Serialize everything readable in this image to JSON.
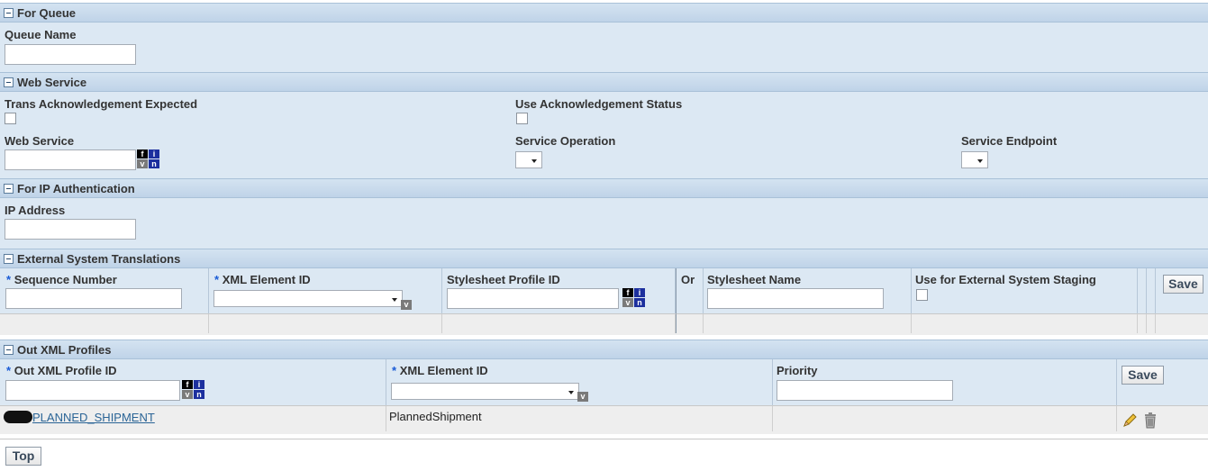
{
  "for_queue": {
    "title": "For Queue",
    "queue_name_label": "Queue Name",
    "queue_name_value": ""
  },
  "web_service": {
    "title": "Web Service",
    "trans_ack_label": "Trans Acknowledgement Expected",
    "use_ack_label": "Use Acknowledgement Status",
    "web_service_label": "Web Service",
    "web_service_value": "",
    "service_operation_label": "Service Operation",
    "service_endpoint_label": "Service Endpoint"
  },
  "ip_auth": {
    "title": "For IP Authentication",
    "ip_label": "IP Address",
    "ip_value": ""
  },
  "ext_trans": {
    "title": "External System Translations",
    "req_mark": "*",
    "seq_label": "Sequence Number",
    "xml_elem_label": "XML Element ID",
    "stylesheet_profile_label": "Stylesheet Profile ID",
    "or_label": "Or",
    "stylesheet_name_label": "Stylesheet Name",
    "use_staging_label": "Use for External System Staging",
    "save_label": "Save"
  },
  "out_xml": {
    "title": "Out XML Profiles",
    "req_mark": "*",
    "profile_label": "Out XML Profile ID",
    "xml_elem_label": "XML Element ID",
    "priority_label": "Priority",
    "save_label": "Save",
    "rows": [
      {
        "profile": "PLANNED_SHIPMENT",
        "xml_element": "PlannedShipment",
        "priority": ""
      }
    ]
  },
  "lookup_icon": {
    "f": "f",
    "i": "i",
    "v": "v",
    "n": "n"
  },
  "v_badge": "v",
  "top_label": "Top"
}
